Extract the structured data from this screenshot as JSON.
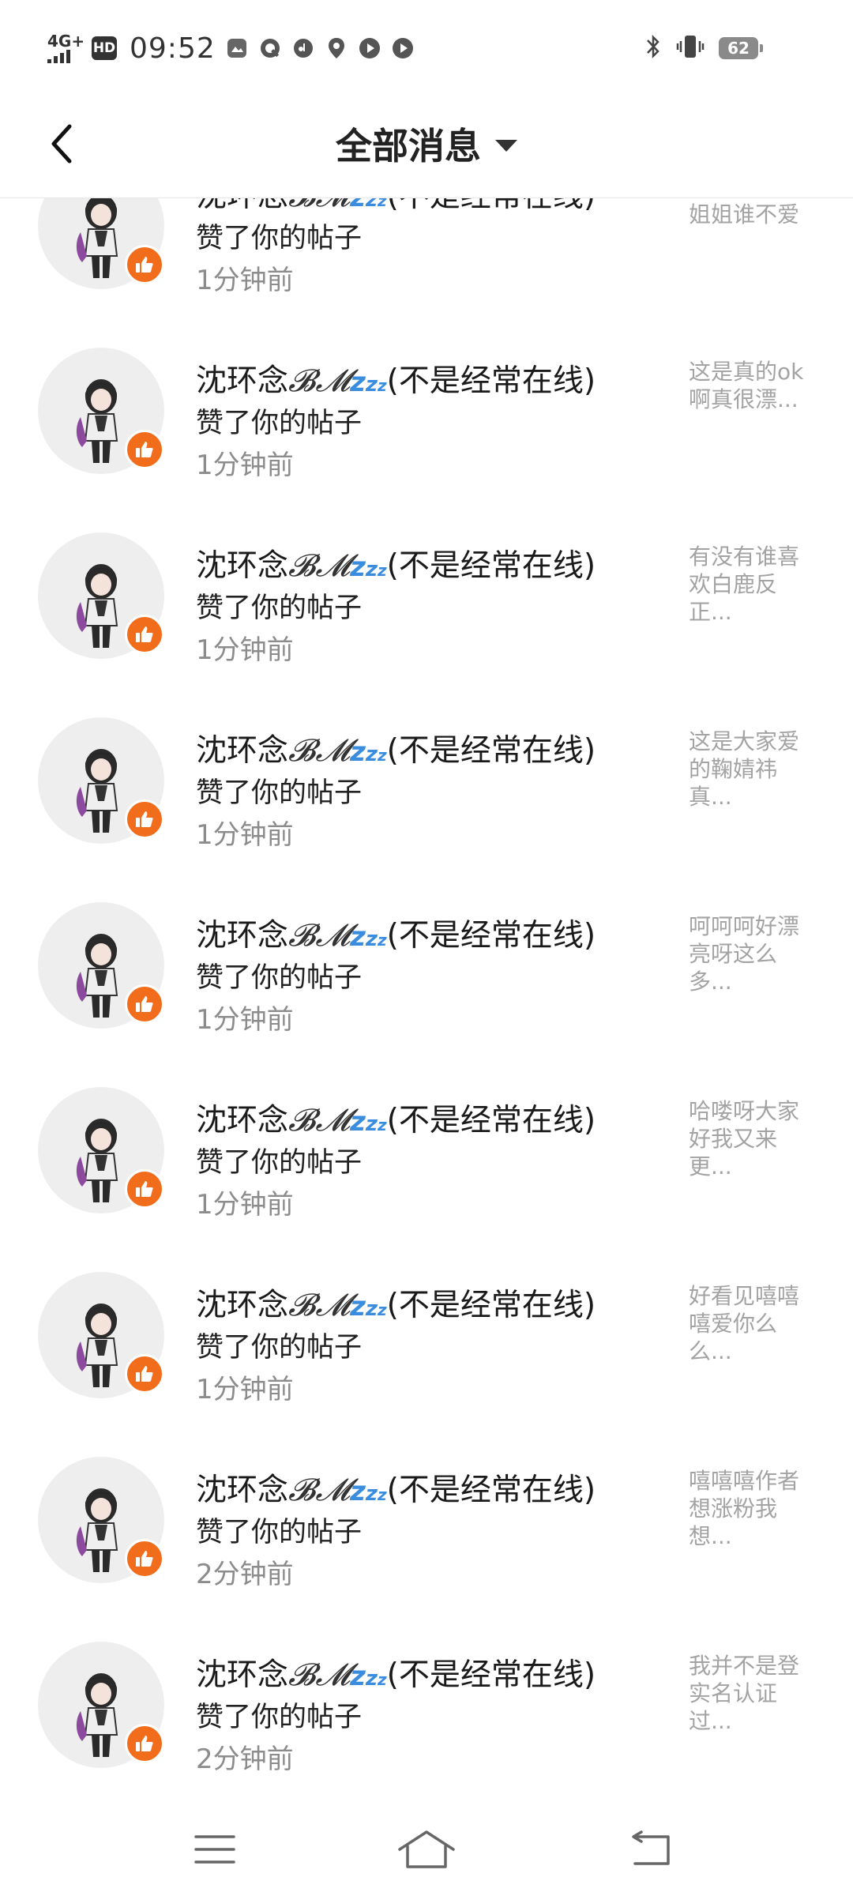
{
  "status_bar": {
    "network": "4G+",
    "hd": "HD",
    "time": "09:52",
    "battery": "62"
  },
  "header": {
    "title": "全部消息"
  },
  "notifications": [
    {
      "name": "沈环念",
      "name_script": "𝓑𝓜",
      "name_zzz": "z",
      "name_suffix": "(不是经常在线)",
      "action": "赞了你的帖子",
      "time": "1分钟前",
      "preview": "这么漂亮的姐姐谁不爱"
    },
    {
      "name": "沈环念",
      "name_script": "𝓑𝓜",
      "name_zzz": "z",
      "name_suffix": "(不是经常在线)",
      "action": "赞了你的帖子",
      "time": "1分钟前",
      "preview": "这是真的ok啊真很漂..."
    },
    {
      "name": "沈环念",
      "name_script": "𝓑𝓜",
      "name_zzz": "z",
      "name_suffix": "(不是经常在线)",
      "action": "赞了你的帖子",
      "time": "1分钟前",
      "preview": "有没有谁喜欢白鹿反正..."
    },
    {
      "name": "沈环念",
      "name_script": "𝓑𝓜",
      "name_zzz": "z",
      "name_suffix": "(不是经常在线)",
      "action": "赞了你的帖子",
      "time": "1分钟前",
      "preview": "这是大家爱的鞠婧祎真..."
    },
    {
      "name": "沈环念",
      "name_script": "𝓑𝓜",
      "name_zzz": "z",
      "name_suffix": "(不是经常在线)",
      "action": "赞了你的帖子",
      "time": "1分钟前",
      "preview": "呵呵呵好漂亮呀这么多..."
    },
    {
      "name": "沈环念",
      "name_script": "𝓑𝓜",
      "name_zzz": "z",
      "name_suffix": "(不是经常在线)",
      "action": "赞了你的帖子",
      "time": "1分钟前",
      "preview": "哈喽呀大家好我又来更..."
    },
    {
      "name": "沈环念",
      "name_script": "𝓑𝓜",
      "name_zzz": "z",
      "name_suffix": "(不是经常在线)",
      "action": "赞了你的帖子",
      "time": "1分钟前",
      "preview": "好看见嘻嘻嘻爱你么么..."
    },
    {
      "name": "沈环念",
      "name_script": "𝓑𝓜",
      "name_zzz": "z",
      "name_suffix": "(不是经常在线)",
      "action": "赞了你的帖子",
      "time": "2分钟前",
      "preview": "嘻嘻嘻作者想涨粉我想..."
    },
    {
      "name": "沈环念",
      "name_script": "𝓑𝓜",
      "name_zzz": "z",
      "name_suffix": "(不是经常在线)",
      "action": "赞了你的帖子",
      "time": "2分钟前",
      "preview": "我并不是登实名认证过..."
    }
  ],
  "icons": {
    "back": "back-arrow-icon",
    "dropdown": "caret-down-icon",
    "badge": "thumbs-up-icon",
    "nav_menu": "menu-icon",
    "nav_home": "home-icon",
    "nav_back": "return-icon"
  },
  "colors": {
    "badge": "#f26d1b",
    "avatar_bg": "#eeeeee",
    "preview_text": "#a3a3a3",
    "time_text": "#8c8c8c"
  }
}
